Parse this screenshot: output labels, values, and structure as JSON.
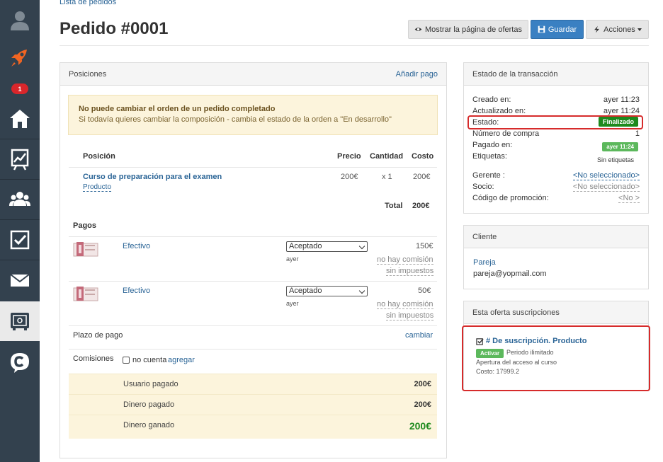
{
  "breadcrumb": "Lista de pedidos",
  "title": "Pedido #0001",
  "header_buttons": {
    "show_offers": "Mostrar la página de ofertas",
    "save": "Guardar",
    "actions": "Acciones"
  },
  "sidebar": {
    "badge_count": "1"
  },
  "positions_panel": {
    "title": "Posiciones",
    "add_payment": "Añadir pago",
    "alert": {
      "title": "No puede cambiar el orden de un pedido completado",
      "text": "Si todavía quieres cambiar la composición - cambia el estado de la orden a \"En desarrollo\""
    },
    "columns": {
      "position": "Posición",
      "price": "Precio",
      "quantity": "Cantidad",
      "cost": "Costo"
    },
    "item": {
      "name": "Curso de preparación para el examen",
      "type": "Producto",
      "price": "200€",
      "quantity": "x 1",
      "cost": "200€"
    },
    "total_label": "Total",
    "total_value": "200€",
    "payments_title": "Pagos",
    "payments": [
      {
        "method": "Efectivo",
        "status": "Aceptado",
        "when": "ayer",
        "amount": "150€",
        "commission": "no hay comisión",
        "tax": "sin impuestos"
      },
      {
        "method": "Efectivo",
        "status": "Aceptado",
        "when": "ayer",
        "amount": "50€",
        "commission": "no hay comisión",
        "tax": "sin impuestos"
      }
    ],
    "payment_term_label": "Plazo de pago",
    "payment_term_action": "cambiar",
    "commissions_label": "Comisiones",
    "commissions_checkbox": "no cuenta",
    "commissions_add": "agregar",
    "summary": [
      {
        "label": "Usuario pagado",
        "value": "200€"
      },
      {
        "label": "Dinero pagado",
        "value": "200€"
      },
      {
        "label": "Dinero ganado",
        "value": "200€"
      }
    ]
  },
  "transaction_panel": {
    "title": "Estado de la transacción",
    "created_label": "Creado en:",
    "created_value": "ayer 11:23",
    "updated_label": "Actualizado en:",
    "updated_value": "ayer 11:24",
    "status_label": "Estado:",
    "status_value": "Finalizado",
    "purchase_number_label": "Número de compra",
    "purchase_number_value": "1",
    "paid_label": "Pagado en:",
    "paid_value": "ayer 11:24",
    "tags_label": "Etiquetas:",
    "tags_value": "Sin etiquetas",
    "manager_label": "Gerente :",
    "manager_value": "<No seleccionado>",
    "partner_label": "Socio:",
    "partner_value": "<No seleccionado>",
    "promo_label": "Código de promoción:",
    "promo_value": "<No >"
  },
  "client_panel": {
    "title": "Cliente",
    "name": "Pareja",
    "email": "pareja@yopmail.com"
  },
  "subscription_panel": {
    "title": "Esta oferta suscripciones",
    "name": "# De suscripción. Producto",
    "badge": "Activar",
    "period": "Periodo ilimitado",
    "access": "Apertura del acceso al curso",
    "cost": "Costo: 17999.2"
  },
  "colors": {
    "accent": "#3a80c2",
    "sidebar": "#33414e",
    "success": "#1e8a1e",
    "highlight": "#d62b2b",
    "earned": "#1e8a1e"
  }
}
